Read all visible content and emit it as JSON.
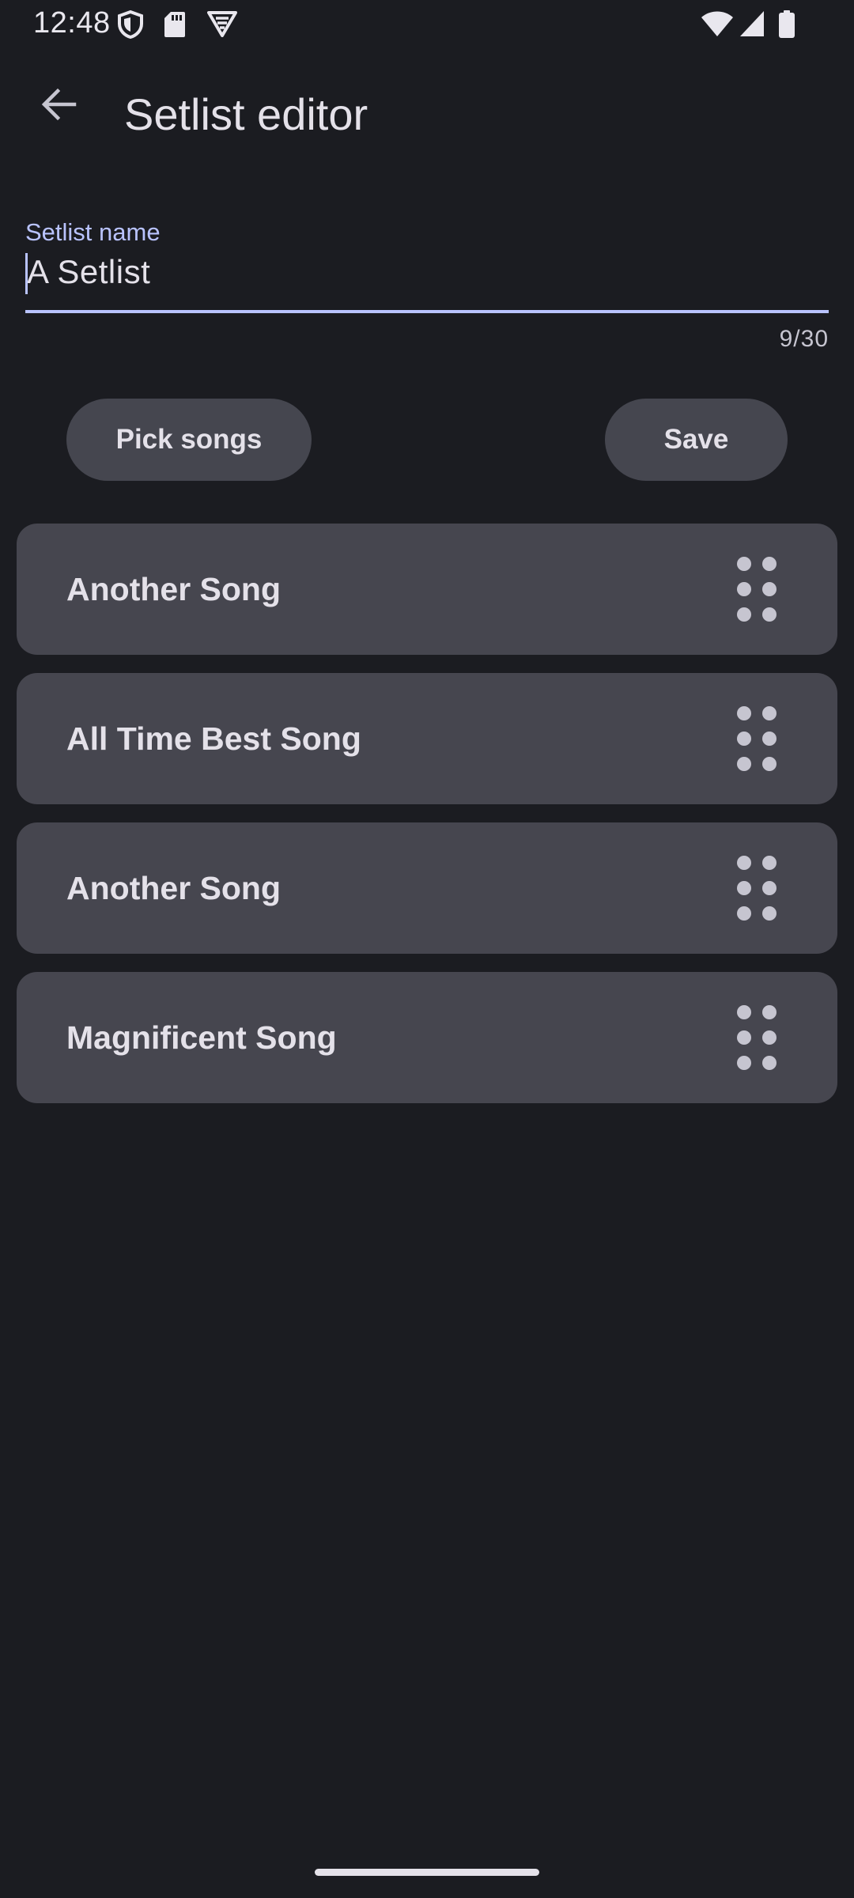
{
  "status_bar": {
    "time": "12:48",
    "left_icons": [
      "shield-icon",
      "sd-card-icon",
      "vpn-icon"
    ],
    "right_icons": [
      "wifi-icon",
      "signal-icon",
      "battery-icon"
    ]
  },
  "app_bar": {
    "back_icon": "arrow-back-icon",
    "title": "Setlist editor"
  },
  "setlist_name_field": {
    "label": "Setlist name",
    "value": "A Setlist",
    "counter": "9/30"
  },
  "actions": {
    "pick_songs_label": "Pick songs",
    "save_label": "Save"
  },
  "songs": [
    {
      "title": "Another Song"
    },
    {
      "title": "All Time Best Song"
    },
    {
      "title": "Another Song"
    },
    {
      "title": "Magnificent Song"
    }
  ],
  "colors": {
    "background": "#1b1c21",
    "accent": "#b9c3ff",
    "surface": "#46464f",
    "on_surface": "#e4e1e9"
  }
}
